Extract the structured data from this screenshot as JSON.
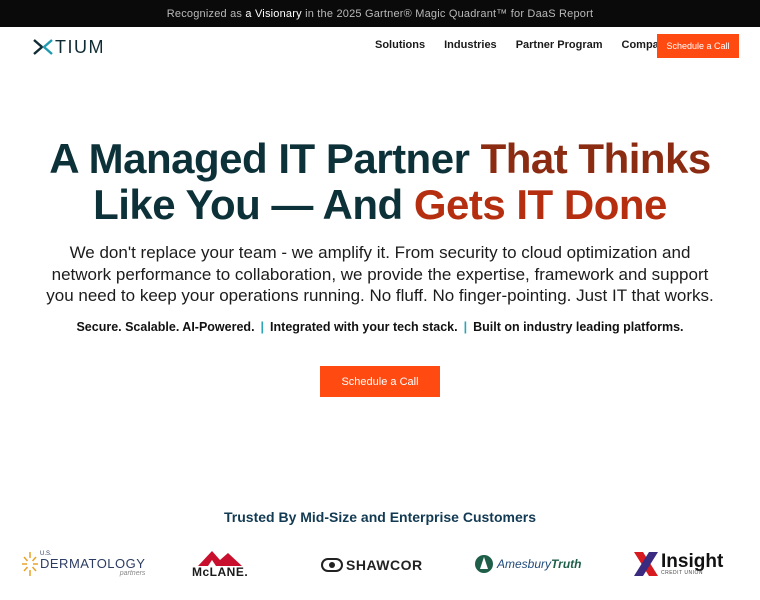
{
  "announcement": {
    "prefix": "Recognized as ",
    "highlight": "a Visionary",
    "suffix": " in the 2025 Gartner® Magic Quadrant™ for DaaS Report"
  },
  "nav": {
    "logo_text": "TIUM",
    "items": [
      "Solutions",
      "Industries",
      "Partner Program",
      "Company"
    ],
    "cta": "Schedule a Call"
  },
  "hero": {
    "title_line1_dark": "A Managed IT Partner ",
    "title_line1_accent": "That Thinks",
    "title_line2_dark": "Like You — And ",
    "title_line2_accent": "Gets IT Done",
    "subtitle": "We don't replace your team - we amplify it. From security to cloud optimization and network performance to collaboration, we provide the expertise, framework and support you need to keep your operations running. No fluff. No finger-pointing. Just IT that works.",
    "tagline": [
      "Secure. Scalable. AI-Powered.",
      "Integrated with your tech stack.",
      "Built on industry leading platforms."
    ],
    "tagline_sep": "|",
    "cta": "Schedule a Call"
  },
  "customers": {
    "heading": "Trusted By Mid-Size and Enterprise Customers",
    "logos": [
      {
        "name": "U.S. Dermatology Partners",
        "small": "U.S.",
        "main": "DERMATOLOGY",
        "sub": "partners"
      },
      {
        "name": "McLane",
        "main": "McLANE."
      },
      {
        "name": "Shawcor",
        "main": "SHAWCOR"
      },
      {
        "name": "Amesbury Truth",
        "main": "Amesbury",
        "accent": "Truth"
      },
      {
        "name": "Insight Credit Union",
        "main": "Insight",
        "sub": "CREDIT UNION"
      }
    ]
  },
  "colors": {
    "accent": "#ff4b12",
    "dark_teal": "#0d3138",
    "rust": "#b52e0f",
    "separator": "#2aa6b8",
    "navy": "#123a52"
  }
}
